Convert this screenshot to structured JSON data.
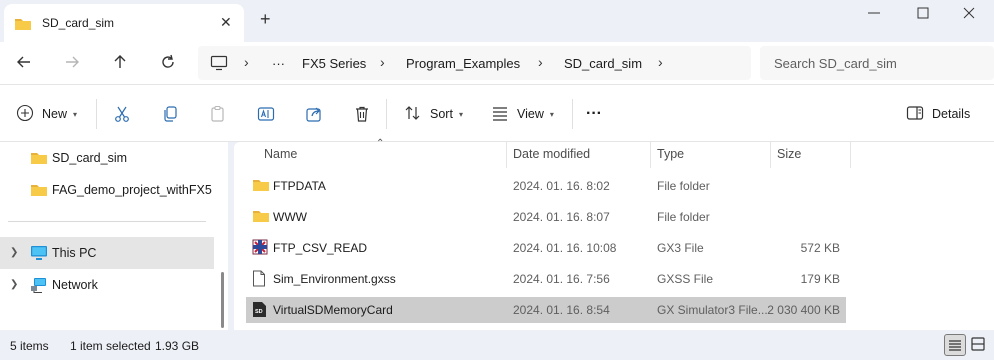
{
  "tab": {
    "title": "SD_card_sim",
    "icon": "folder-icon"
  },
  "nav": {
    "breadcrumbs": [
      "FX5 Series",
      "Program_Examples",
      "SD_card_sim"
    ],
    "overflow": "···"
  },
  "search": {
    "placeholder": "Search SD_card_sim"
  },
  "toolbar": {
    "new_label": "New",
    "sort_label": "Sort",
    "view_label": "View",
    "more_label": "···",
    "details_label": "Details"
  },
  "sidebar": {
    "items": [
      {
        "label": "SD_card_sim",
        "icon": "folder-icon"
      },
      {
        "label": "FAG_demo_project_withFX5",
        "icon": "folder-icon"
      },
      {
        "label": "This PC",
        "icon": "monitor-icon"
      },
      {
        "label": "Network",
        "icon": "network-icon"
      }
    ]
  },
  "table": {
    "columns": [
      "Name",
      "Date modified",
      "Type",
      "Size"
    ],
    "rows": [
      {
        "name": "FTPDATA",
        "date": "2024. 01. 16. 8:02",
        "type": "File folder",
        "size": "",
        "icon": "folder-icon"
      },
      {
        "name": "WWW",
        "date": "2024. 01. 16. 8:07",
        "type": "File folder",
        "size": "",
        "icon": "folder-icon"
      },
      {
        "name": "FTP_CSV_READ",
        "date": "2024. 01. 16. 10:08",
        "type": "GX3 File",
        "size": "572 KB",
        "icon": "gx3-file-icon"
      },
      {
        "name": "Sim_Environment.gxss",
        "date": "2024. 01. 16. 7:56",
        "type": "GXSS File",
        "size": "179 KB",
        "icon": "document-icon"
      },
      {
        "name": "VirtualSDMemoryCard",
        "date": "2024. 01. 16. 8:54",
        "type": "GX Simulator3 File...",
        "size": "2 030 400 KB",
        "icon": "sd-card-icon"
      }
    ]
  },
  "status": {
    "item_count": "5 items",
    "selection": "1 item selected",
    "selection_size": "1.93 GB"
  },
  "colors": {
    "folder": "#f4c542",
    "selection": "#cccccc",
    "accent": "#0067c0"
  }
}
